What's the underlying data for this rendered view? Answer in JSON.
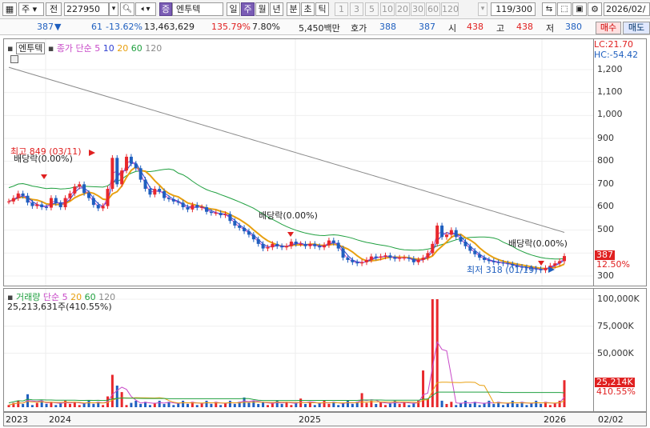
{
  "toolbar": {
    "market": "주",
    "mode": "전",
    "code": "227950",
    "stock_badge": "증",
    "stock_name": "엔투텍",
    "periods": [
      "일",
      "주",
      "월",
      "년",
      "분",
      "초",
      "틱"
    ],
    "period_selected": "주",
    "minutes": [
      "1",
      "3",
      "5",
      "10",
      "20",
      "30",
      "60",
      "120"
    ],
    "count": "119/300",
    "date": "2026/02/"
  },
  "quote": {
    "price": "387",
    "change": "61",
    "change_rate": "-13.62%",
    "volume": "13,463,629",
    "vol_rate": "135.79%",
    "turnover": "7.80%",
    "amount": "5,450백만",
    "hoga_label": "호가",
    "hoga": "388",
    "hoga2": "387",
    "open_label": "시",
    "open": "438",
    "high_label": "고",
    "high": "438",
    "low_label": "저",
    "low": "380",
    "buy": "매수",
    "sell": "매도"
  },
  "price_panel": {
    "name": "엔투텍",
    "legend_prefix": "종가 단순",
    "ma": [
      "5",
      "10",
      "20",
      "60",
      "120"
    ],
    "lc": "LC:21.70",
    "hc": "HC:-54.42",
    "y_ticks": [
      "1,200",
      "1,100",
      "1,000",
      "900",
      "800",
      "700",
      "600",
      "500",
      "400",
      "300"
    ],
    "current_tag": "387",
    "pct_tag": "12.50%",
    "annotations": {
      "high": "최고 849 (03/11)",
      "low": "최저 318 (01/19)",
      "div1": "배당락(0.00%)",
      "div2": "배당락(0.00%)",
      "div3": "배당락(0.00%)"
    }
  },
  "volume_panel": {
    "name": "거래량",
    "legend_prefix": "단순",
    "ma": [
      "5",
      "20",
      "60",
      "120"
    ],
    "info": "25,213,631주(410.55%)",
    "y_ticks": [
      "100,000K",
      "75,000K",
      "50,000K"
    ],
    "current_tag": "25,214K",
    "pct_tag": "410.55%"
  },
  "xaxis": {
    "labels": [
      "2023",
      "2024",
      "2025",
      "2026",
      "02/02"
    ]
  },
  "colors": {
    "up": "#e8282c",
    "down": "#1f5fbf",
    "ma5": "#c84ac8",
    "ma10": "#3040d0",
    "ma20": "#e8a010",
    "ma60": "#20a040",
    "ma120": "#8a8a8a"
  },
  "chart_data": {
    "type": "candlestick",
    "series_close": [
      625,
      640,
      660,
      650,
      620,
      605,
      612,
      600,
      598,
      640,
      618,
      600,
      640,
      660,
      690,
      700,
      662,
      640,
      610,
      595,
      605,
      680,
      815,
      700,
      760,
      820,
      790,
      770,
      720,
      680,
      655,
      680,
      670,
      640,
      635,
      625,
      620,
      600,
      590,
      610,
      598,
      600,
      580,
      575,
      575,
      565,
      570,
      540,
      520,
      510,
      495,
      480,
      460,
      440,
      420,
      425,
      440,
      430,
      425,
      430,
      450,
      440,
      440,
      430,
      440,
      430,
      425,
      435,
      455,
      445,
      420,
      380,
      370,
      360,
      355,
      360,
      370,
      385,
      380,
      385,
      390,
      380,
      375,
      380,
      380,
      375,
      360,
      370,
      380,
      400,
      440,
      520,
      470,
      480,
      500,
      470,
      450,
      430,
      410,
      395,
      380,
      370,
      365,
      360,
      358,
      355,
      352,
      345,
      340,
      338,
      335,
      332,
      330,
      325,
      335,
      345,
      355,
      365,
      387
    ],
    "volume_approx_K": "0–100,000"
  }
}
